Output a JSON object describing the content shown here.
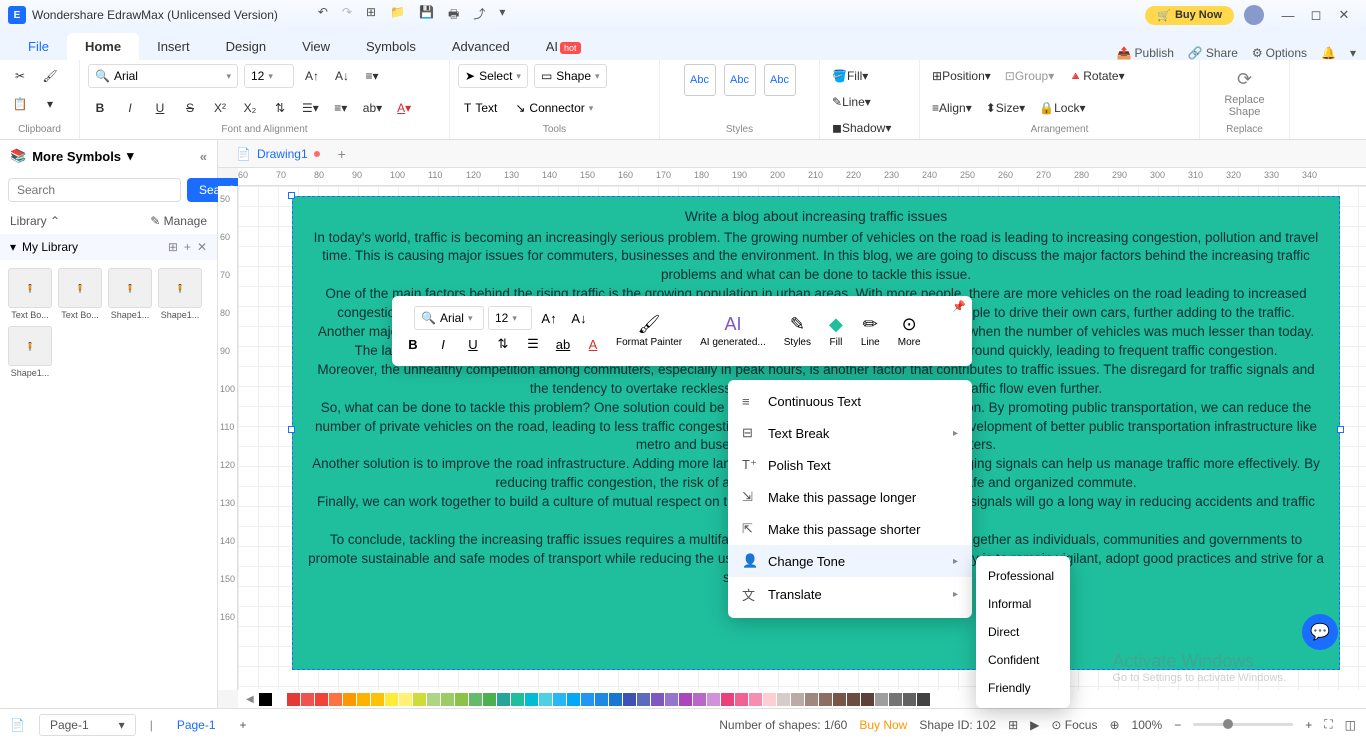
{
  "titlebar": {
    "app_title": "Wondershare EdrawMax (Unlicensed Version)",
    "buy_label": "Buy Now"
  },
  "menu": {
    "file": "File",
    "home": "Home",
    "insert": "Insert",
    "design": "Design",
    "view": "View",
    "symbols": "Symbols",
    "advanced": "Advanced",
    "ai": "AI",
    "ai_badge": "hot",
    "publish": "Publish",
    "share": "Share",
    "options": "Options"
  },
  "ribbon": {
    "clipboard_label": "Clipboard",
    "font_name": "Arial",
    "font_size": "12",
    "font_label": "Font and Alignment",
    "select": "Select",
    "shape": "Shape",
    "text": "Text",
    "connector": "Connector",
    "tools_label": "Tools",
    "style_abc": "Abc",
    "styles_label": "Styles",
    "fill": "Fill",
    "line": "Line",
    "shadow": "Shadow",
    "position": "Position",
    "align": "Align",
    "group": "Group",
    "size": "Size",
    "rotate": "Rotate",
    "lock": "Lock",
    "arrangement_label": "Arrangement",
    "replace_shape": "Replace Shape",
    "replace_label": "Replace"
  },
  "leftpanel": {
    "more_symbols": "More Symbols",
    "search_placeholder": "Search",
    "search_btn": "Search",
    "library": "Library",
    "manage": "Manage",
    "my_library": "My Library",
    "thumbs": [
      "Text Bo...",
      "Text Bo...",
      "Shape1...",
      "Shape1...",
      "Shape1..."
    ]
  },
  "doctab": {
    "name": "Drawing1"
  },
  "document": {
    "title": "Write a blog about increasing traffic issues",
    "p1": "In today's world, traffic is becoming an increasingly serious problem. The growing number of vehicles on the road is leading to increasing congestion, pollution and travel time. This is causing major issues for commuters, businesses and the environment. In this blog, we are going to discuss the major factors behind the increasing traffic problems and what can be done to tackle this issue.",
    "p2": "One of the main factors behind the rising traffic is the growing population in urban areas. With more people, there are more vehicles on the road leading to increased congestion. Additionally, many cities do not have an efficient public transportation system which forces people to drive their own cars, further adding to the traffic.",
    "p3": "Another major factor is the poor road infrastructure. Many cities have roads that were designed decades ago when the number of vehicles was much lesser than today. The lack of proper highways, flyovers, and well-maintained roads make it difficult for vehicles to move around quickly, leading to frequent traffic congestion.",
    "p4": "Moreover, the unhealthy competition among commuters, especially in peak hours, is another factor that contributes to traffic issues. The disregard for traffic signals and the tendency to overtake recklessly causes accidents, slowing down the traffic flow even further.",
    "p5": "So, what can be done to tackle this problem? One solution could be to promote the use of public transportation. By promoting public transportation, we can reduce the number of private vehicles on the road, leading to less traffic congestion. The government can invest in the development of better public transportation infrastructure like metro and buses to make it more convenient for commuters.",
    "p6": "Another solution is to improve the road infrastructure. Adding more lanes, building highways and flyovers, merging signals can help us manage traffic more effectively. By reducing traffic congestion, the risk of accidents can be reduced, promoting a safe and organized commute.",
    "p7": "Finally, we can work together to build a culture of mutual respect on the road. Following traffic rules and obey signals will go a long way in reducing accidents and traffic flow.",
    "p8": "To conclude, tackling the increasing traffic issues requires a multifaceted approach. It is important to work together as individuals, communities and governments to promote sustainable and safe modes of transport while reducing the use of private vehicles on the road. The key is to remain vigilant, adopt good practices and strive for a safer and cleaner environment."
  },
  "float_toolbar": {
    "font": "Arial",
    "size": "12",
    "format_painter": "Format Painter",
    "ai_gen": "AI generated...",
    "styles": "Styles",
    "fill": "Fill",
    "line": "Line",
    "more": "More"
  },
  "context_menu": {
    "continuous": "Continuous Text",
    "text_break": "Text Break",
    "polish": "Polish Text",
    "longer": "Make this passage longer",
    "shorter": "Make this passage shorter",
    "change_tone": "Change Tone",
    "translate": "Translate"
  },
  "tone_submenu": {
    "professional": "Professional",
    "informal": "Informal",
    "direct": "Direct",
    "confident": "Confident",
    "friendly": "Friendly"
  },
  "statusbar": {
    "page_sel": "Page-1",
    "page_tab": "Page-1",
    "shapes_count": "Number of shapes: 1/60",
    "buy_now": "Buy Now",
    "shape_id": "Shape ID: 102",
    "focus": "Focus",
    "zoom": "100%"
  },
  "watermark": {
    "line1": "Activate Windows",
    "line2": "Go to Settings to activate Windows."
  },
  "hruler_ticks": [
    "60",
    "70",
    "80",
    "90",
    "100",
    "110",
    "120",
    "130",
    "140",
    "150",
    "160",
    "170",
    "180",
    "190",
    "200",
    "210",
    "220",
    "230",
    "240",
    "250",
    "260",
    "270",
    "280",
    "290",
    "300",
    "310",
    "320",
    "330",
    "340"
  ],
  "vruler_ticks": [
    "50",
    "60",
    "70",
    "80",
    "90",
    "100",
    "110",
    "120",
    "130",
    "140",
    "150",
    "160"
  ],
  "colorbar": [
    "#000",
    "#fff",
    "#e53935",
    "#ef5350",
    "#f44336",
    "#ff7043",
    "#ff9800",
    "#ffb300",
    "#ffc107",
    "#ffeb3b",
    "#fff176",
    "#cddc39",
    "#aed581",
    "#9ccc65",
    "#8bc34a",
    "#66bb6a",
    "#4caf50",
    "#26a69a",
    "#1fbf9e",
    "#00bcd4",
    "#4dd0e1",
    "#29b6f6",
    "#03a9f4",
    "#2196f3",
    "#1e88e5",
    "#1976d2",
    "#3f51b5",
    "#5c6bc0",
    "#7e57c2",
    "#9575cd",
    "#ab47bc",
    "#ba68c8",
    "#ce93d8",
    "#ec407a",
    "#f06292",
    "#f48fb1",
    "#ffcdd2",
    "#d7ccc8",
    "#bcaaa4",
    "#a1887f",
    "#8d6e63",
    "#795548",
    "#6d4c41",
    "#5d4037",
    "#9e9e9e",
    "#757575",
    "#616161",
    "#424242"
  ]
}
